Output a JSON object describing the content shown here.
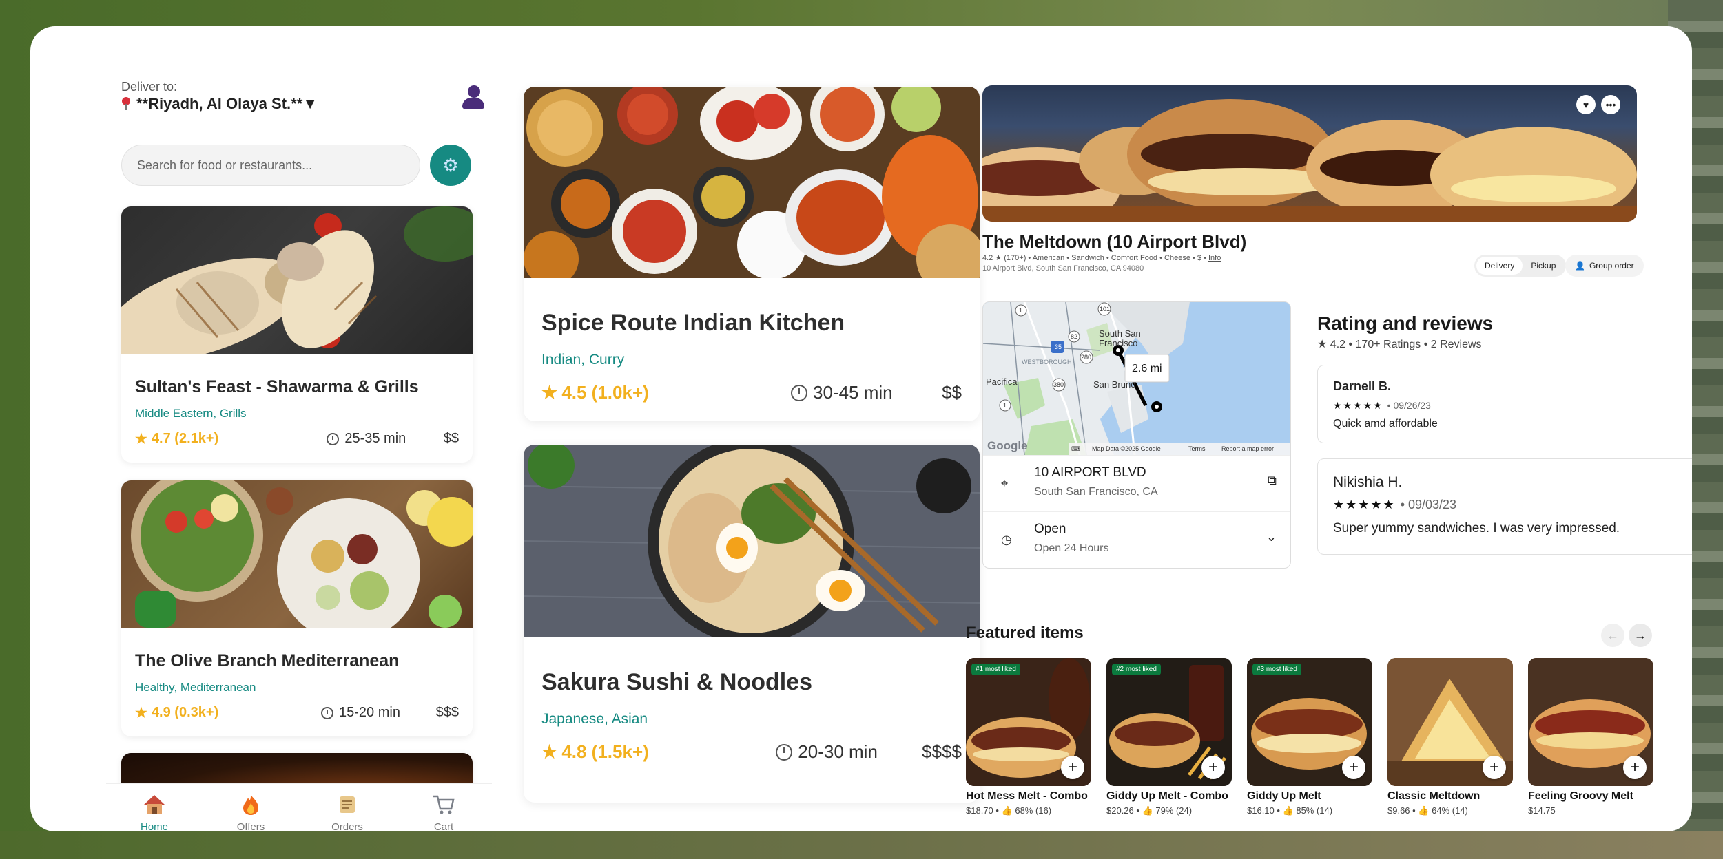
{
  "colors": {
    "accent": "#168a82",
    "rating": "#f2b01e",
    "badge": "#0b7a3e"
  },
  "header": {
    "deliver_label": "Deliver to:",
    "location": "**Riyadh, Al Olaya St.**▼"
  },
  "search": {
    "placeholder": "Search for food or restaurants..."
  },
  "restaurants": [
    {
      "name": "Sultan's Feast - Shawarma & Grills",
      "cuisine": "Middle Eastern, Grills",
      "rating": "4.7 (2.1k+)",
      "time": "25-35 min",
      "price": "$$"
    },
    {
      "name": "The Olive Branch Mediterranean",
      "cuisine": "Healthy, Mediterranean",
      "rating": "4.9 (0.3k+)",
      "time": "15-20 min",
      "price": "$$$"
    }
  ],
  "featured_restaurants": [
    {
      "name": "Spice Route Indian Kitchen",
      "cuisine": "Indian, Curry",
      "rating": "4.5 (1.0k+)",
      "time": "30-45 min",
      "price": "$$"
    },
    {
      "name": "Sakura Sushi & Noodles",
      "cuisine": "Japanese, Asian",
      "rating": "4.8 (1.5k+)",
      "time": "20-30 min",
      "price": "$$$$"
    }
  ],
  "nav": [
    {
      "label": "Home",
      "icon": "home-icon"
    },
    {
      "label": "Offers",
      "icon": "flame-icon"
    },
    {
      "label": "Orders",
      "icon": "scroll-icon"
    },
    {
      "label": "Cart",
      "icon": "cart-icon"
    }
  ],
  "store": {
    "name": "The Meltdown (10 Airport Blvd)",
    "subline": "4.2 ★ (170+) • American • Sandwich • Comfort Food • Cheese • $ •",
    "info_link": "Info",
    "address": "10 Airport Blvd, South San Francisco, CA 94080",
    "delivery_label": "Delivery",
    "pickup_label": "Pickup",
    "group_order_label": "Group order"
  },
  "map": {
    "distance": "2.6 mi",
    "labels": [
      "South San",
      "Francisco",
      "Pacifica",
      "San Bruno",
      "WESTBOROUGH"
    ],
    "route_numbers": [
      "1",
      "101",
      "82",
      "280",
      "35",
      "380",
      "1"
    ],
    "footer": [
      "Map Data ©2025 Google",
      "Terms",
      "Report a map error"
    ],
    "logo": "Google"
  },
  "location_info": {
    "address": "10 AIRPORT BLVD",
    "city": "South San Francisco, CA",
    "status": "Open",
    "hours": "Open 24 Hours"
  },
  "reviews": {
    "title": "Rating and reviews",
    "summary": "★ 4.2 • 170+ Ratings • 2 Reviews",
    "items": [
      {
        "name": "Darnell B.",
        "stars": "★★★★★",
        "date": "• 09/26/23",
        "text": "Quick amd affordable"
      },
      {
        "name": "Nikishia H.",
        "stars": "★★★★★",
        "date": "• 09/03/23",
        "text": "Super yummy sandwiches. I was very impressed."
      }
    ]
  },
  "featured_items": {
    "title": "Featured items",
    "items": [
      {
        "name": "Hot Mess Melt - Combo",
        "meta": "$18.70 • 👍 68% (16)",
        "badge": "#1 most liked"
      },
      {
        "name": "Giddy Up Melt - Combo",
        "meta": "$20.26 • 👍 79% (24)",
        "badge": "#2 most liked"
      },
      {
        "name": "Giddy Up Melt",
        "meta": "$16.10 • 👍 85% (14)",
        "badge": "#3 most liked"
      },
      {
        "name": "Classic Meltdown",
        "meta": "$9.66 • 👍 64% (14)",
        "badge": ""
      },
      {
        "name": "Feeling Groovy Melt",
        "meta": "$14.75",
        "badge": ""
      }
    ]
  }
}
